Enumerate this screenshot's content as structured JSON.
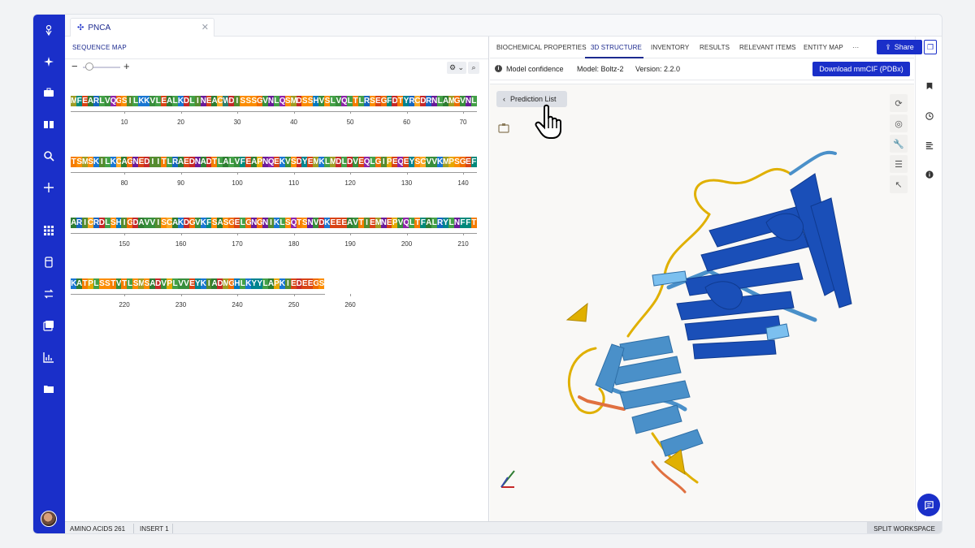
{
  "tab": {
    "title": "PNCA",
    "close": "✕"
  },
  "left": {
    "tab_label": "SEQUENCE MAP",
    "zoom_minus": "−",
    "zoom_plus": "+",
    "tool_settings": "⚙ ⌄",
    "tool_search": "⌕",
    "rows": [
      {
        "seq": "MFEARLVQGSILKKVLEALKDLINEACWDISSSGVNLQSMDSSHVSLVQLTLRSEGFDTYRCDRNLAMGVNL",
        "ticks": [
          "10",
          "20",
          "30",
          "40",
          "50",
          "60",
          "70"
        ]
      },
      {
        "seq": "TSMSKILKCAGNEDIITLRAEDNADTLALVFEAPNQEKVSDYEMKLMDLDVEQLGIPEQEYSCVVKMPSGEF",
        "ticks": [
          "80",
          "90",
          "100",
          "110",
          "120",
          "130",
          "140"
        ]
      },
      {
        "seq": "ARICRDLSHIGDAVVISCAKDGVKFSASGELGNGNIKLSQTSNVDKEEEAVTIEMNEPVQLTFALRYLNFFT",
        "ticks": [
          "150",
          "160",
          "170",
          "180",
          "190",
          "200",
          "210"
        ]
      },
      {
        "seq": "KATPLSSTVTLSMSADVPLVVEYKIADMGHLKYYLAPKIEDEEGS",
        "ticks": [
          "220",
          "230",
          "240",
          "250",
          "260"
        ]
      }
    ],
    "aa_colors": {
      "A": "#2e7d32",
      "R": "#1565c0",
      "N": "#6a1b9a",
      "D": "#c62828",
      "C": "#f9a825",
      "Q": "#8e24aa",
      "E": "#d84315",
      "G": "#ef6c00",
      "H": "#0277bd",
      "I": "#558b2f",
      "L": "#43a047",
      "K": "#1976d2",
      "M": "#9e9d24",
      "F": "#00897b",
      "P": "#e6a800",
      "S": "#fb8c00",
      "T": "#f57c00",
      "W": "#2e7d6b",
      "Y": "#00838f",
      "V": "#388e3c"
    }
  },
  "right": {
    "tabs": [
      "BIOCHEMICAL PROPERTIES",
      "3D STRUCTURE",
      "INVENTORY",
      "RESULTS",
      "RELEVANT ITEMS",
      "ENTITY MAP",
      "···"
    ],
    "active_tab": "3D STRUCTURE",
    "share_label": "Share",
    "info": {
      "confidence": "Model confidence",
      "model": "Model: Boltz-2",
      "version": "Version: 2.2.0",
      "download": "Download mmCIF (PDBx)"
    },
    "prediction_btn": "Prediction List"
  },
  "status": {
    "amino_acids": "AMINO ACIDS 261",
    "insert": "INSERT 1",
    "split": "SPLIT WORKSPACE"
  },
  "colors": {
    "brand": "#1a2fc9",
    "helix_dark": "#1a4fb8",
    "sheet_mid": "#4a90c9",
    "coil_yellow": "#e0b000",
    "coil_orange": "#e07040"
  }
}
